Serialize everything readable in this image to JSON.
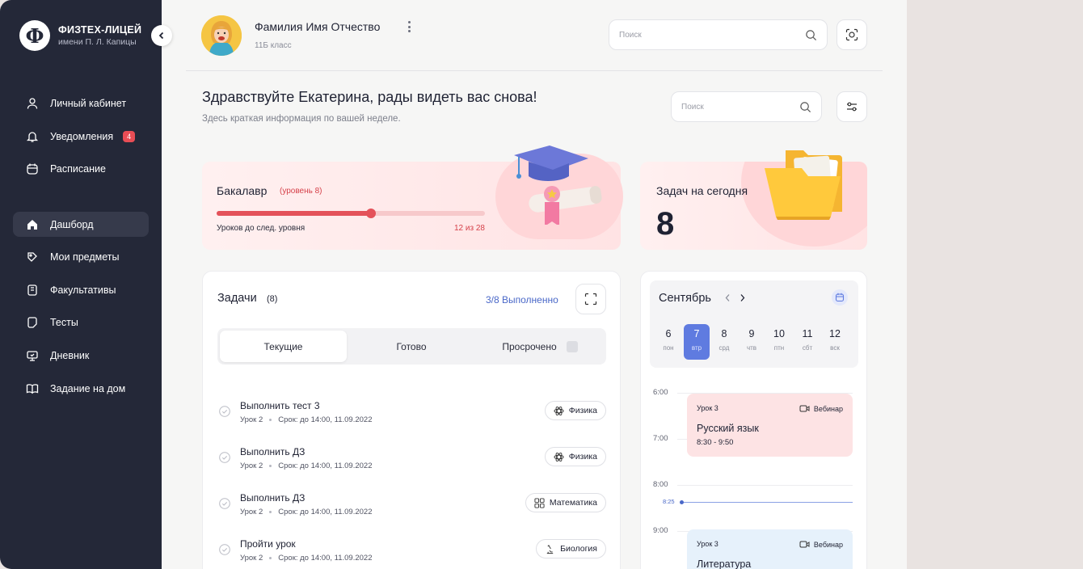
{
  "sidebar": {
    "logo_glyph": "Ф",
    "brand_title": "ФИЗТЕХ-ЛИЦЕЙ",
    "brand_subtitle": "имени П. Л. Капицы",
    "collapse_icon": "chevron-left-icon",
    "items": [
      {
        "label": "Личный кабинет",
        "icon": "user-icon"
      },
      {
        "label": "Уведомления",
        "icon": "bell-icon",
        "badge": "4"
      },
      {
        "label": "Расписание",
        "icon": "calendar-icon"
      },
      {
        "label": "Дашборд",
        "icon": "home-icon",
        "active": true
      },
      {
        "label": "Мои предметы",
        "icon": "subjects-icon"
      },
      {
        "label": "Факультативы",
        "icon": "book-icon"
      },
      {
        "label": "Тесты",
        "icon": "test-icon"
      },
      {
        "label": "Дневник",
        "icon": "monitor-icon"
      },
      {
        "label": "Задание на дом",
        "icon": "open-book-icon"
      }
    ]
  },
  "header": {
    "user_name": "Фамилия Имя Отчество",
    "user_class": "11Б класс",
    "search_placeholder": "Поиск"
  },
  "greeting": {
    "title": "Здравствуйте Екатерина, рады видеть вас снова!",
    "subtitle": "Здесь краткая информация по вашей неделе.",
    "search_placeholder": "Поиск"
  },
  "level_card": {
    "title": "Бакалавр",
    "level": "(уровень 8)",
    "caption": "Уроков до след. уровня",
    "count": "12 из 28",
    "progress": 0.575,
    "icon": "graduation-cap-icon"
  },
  "today_card": {
    "title": "Задач на сегодня",
    "value": "8",
    "icon": "folder-icon"
  },
  "tasks": {
    "title": "Задачи",
    "count": "(8)",
    "done": "3/8 Выполненно",
    "tabs": [
      "Текущие",
      "Готово",
      "Просрочено"
    ],
    "items": [
      {
        "name": "Выполнить тест 3",
        "lesson": "Урок 2",
        "deadline": "Срок: до 14:00, 11.09.2022",
        "subject": "Физика"
      },
      {
        "name": "Выполнить ДЗ",
        "lesson": "Урок 2",
        "deadline": "Срок: до 14:00, 11.09.2022",
        "subject": "Физика"
      },
      {
        "name": "Выполнить ДЗ",
        "lesson": "Урок 2",
        "deadline": "Срок: до 14:00, 11.09.2022",
        "subject": "Математика"
      },
      {
        "name": "Пройти урок",
        "lesson": "Урок 2",
        "deadline": "Срок: до 14:00, 11.09.2022",
        "subject": "Биология"
      }
    ]
  },
  "calendar": {
    "month": "Сентябрь",
    "days": [
      {
        "num": "6",
        "name": "пон"
      },
      {
        "num": "7",
        "name": "втр",
        "active": true
      },
      {
        "num": "8",
        "name": "срд"
      },
      {
        "num": "9",
        "name": "чтв"
      },
      {
        "num": "10",
        "name": "птн"
      },
      {
        "num": "11",
        "name": "сбт"
      },
      {
        "num": "12",
        "name": "вск"
      }
    ],
    "times": [
      "6:00",
      "7:00",
      "8:00",
      "9:00"
    ],
    "now": "8:25",
    "events": [
      {
        "lesson": "Урок 3",
        "type": "Вебинар",
        "subject": "Русский язык",
        "time": "8:30 - 9:50",
        "color": "#fde3e4"
      },
      {
        "lesson": "Урок 3",
        "type": "Вебинар",
        "subject": "Литература",
        "time": "",
        "color": "#e6f1fb"
      }
    ]
  },
  "colors": {
    "accent": "#5f7be0",
    "danger": "#e4525a",
    "sidebar": "#242838"
  }
}
